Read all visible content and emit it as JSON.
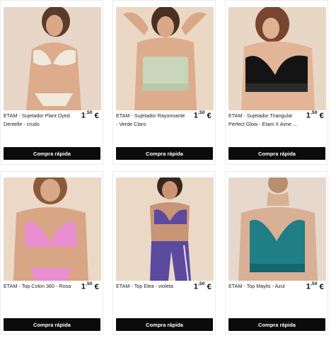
{
  "products": [
    {
      "title": "ETAM - Sujetador Plant Dyed Dentelle - crudo",
      "price_int": "1",
      "price_dec": ",50",
      "currency": "€",
      "button": "Compra rápida",
      "image_alt": "Model wearing lace bralette",
      "bg": "#e8d6c8",
      "garment": "#efe9dc"
    },
    {
      "title": "ETAM - Sujetador Rayonnante - Verde Claro",
      "price_int": "1",
      "price_dec": ",50",
      "currency": "€",
      "button": "Compra rápida",
      "image_alt": "Model wearing light green bandeau",
      "bg": "#ead8c4",
      "garment": "#c9d6bc"
    },
    {
      "title": "ETAM - Sujetador Triangular Perfect Glow - Etam X Aime ...",
      "price_int": "1",
      "price_dec": ",50",
      "currency": "€",
      "button": "Compra rápida",
      "image_alt": "Model wearing black satin bra",
      "bg": "#e9d7c6",
      "garment": "#141414"
    },
    {
      "title": "ETAM - Top Colon 360 - Rosa",
      "price_int": "1",
      "price_dec": ",50",
      "currency": "€",
      "button": "Compra rápida",
      "image_alt": "Model wearing pink top",
      "bg": "#ecd8c6",
      "garment": "#e98fd0"
    },
    {
      "title": "ETAM - Top Elea - violeta",
      "price_int": "1",
      "price_dec": ",50",
      "currency": "€",
      "button": "Compra rápida",
      "image_alt": "Model wearing violet sport top",
      "bg": "#ead9c7",
      "garment": "#5b4a9e"
    },
    {
      "title": "ETAM - Top Maylis - Azul",
      "price_int": "1",
      "price_dec": ",50",
      "currency": "€",
      "button": "Compra rápida",
      "image_alt": "Model wearing teal top",
      "bg": "#e6d8cc",
      "garment": "#1f7e86"
    }
  ]
}
